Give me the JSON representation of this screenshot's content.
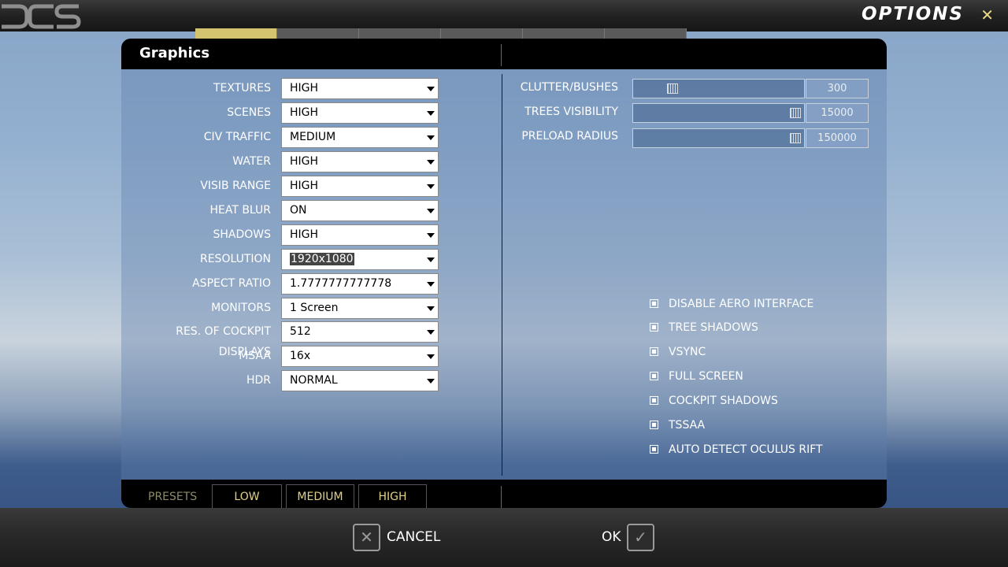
{
  "app": {
    "title": "OPTIONS",
    "close_glyph": "✕"
  },
  "tabs": [
    "",
    "",
    "",
    "",
    "",
    ""
  ],
  "panel": {
    "title": "Graphics"
  },
  "left_options": [
    {
      "label": "TEXTURES",
      "value": "HIGH"
    },
    {
      "label": "SCENES",
      "value": "HIGH"
    },
    {
      "label": "CIV TRAFFIC",
      "value": "MEDIUM"
    },
    {
      "label": "WATER",
      "value": "HIGH"
    },
    {
      "label": "VISIB RANGE",
      "value": "HIGH"
    },
    {
      "label": "HEAT BLUR",
      "value": "ON"
    },
    {
      "label": "SHADOWS",
      "value": "HIGH"
    },
    {
      "label": "RESOLUTION",
      "value": "1920x1080"
    },
    {
      "label": "ASPECT RATIO",
      "value": "1.7777777777778"
    },
    {
      "label": "MONITORS",
      "value": "1 Screen"
    },
    {
      "label": "RES. OF COCKPIT DISPLAYS",
      "value": "512"
    },
    {
      "label": "MSAA",
      "value": "16x"
    },
    {
      "label": "HDR",
      "value": "NORMAL"
    }
  ],
  "sliders": [
    {
      "label": "CLUTTER/BUSHES",
      "value": "300",
      "level": 0.2
    },
    {
      "label": "TREES VISIBILITY",
      "value": "15000",
      "level": 1.0
    },
    {
      "label": "PRELOAD RADIUS",
      "value": "150000",
      "level": 1.0
    }
  ],
  "checkboxes": [
    {
      "label": "DISABLE AERO INTERFACE",
      "checked": true
    },
    {
      "label": "TREE SHADOWS",
      "checked": true
    },
    {
      "label": "VSYNC",
      "checked": true
    },
    {
      "label": "FULL SCREEN",
      "checked": true
    },
    {
      "label": "COCKPIT SHADOWS",
      "checked": true
    },
    {
      "label": "TSSAA",
      "checked": true
    },
    {
      "label": "AUTO DETECT OCULUS RIFT",
      "checked": true
    }
  ],
  "presets": {
    "label": "PRESETS",
    "buttons": [
      "LOW",
      "MEDIUM",
      "HIGH"
    ]
  },
  "actions": {
    "cancel": "CANCEL",
    "ok": "OK",
    "cancel_icon": "✕",
    "ok_icon": "✓"
  },
  "colors": {
    "accent": "#e0d188",
    "tab_active": "#d4c470"
  }
}
